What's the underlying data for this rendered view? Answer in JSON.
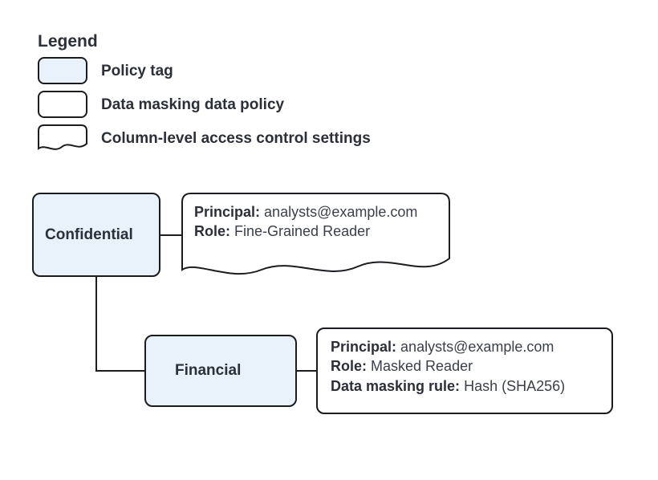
{
  "legend": {
    "title": "Legend",
    "items": [
      {
        "label": "Policy tag"
      },
      {
        "label": "Data masking data policy"
      },
      {
        "label": "Column-level access control settings"
      }
    ]
  },
  "nodes": {
    "confidential": {
      "label": "Confidential",
      "acl": {
        "principal_label": "Principal:",
        "principal_value": "analysts@example.com",
        "role_label": "Role:",
        "role_value": "Fine-Grained Reader"
      }
    },
    "financial": {
      "label": "Financial",
      "policy": {
        "principal_label": "Principal:",
        "principal_value": "analysts@example.com",
        "role_label": "Role:",
        "role_value": "Masked Reader",
        "rule_label": "Data masking rule:",
        "rule_value": "Hash (SHA256)"
      }
    }
  }
}
